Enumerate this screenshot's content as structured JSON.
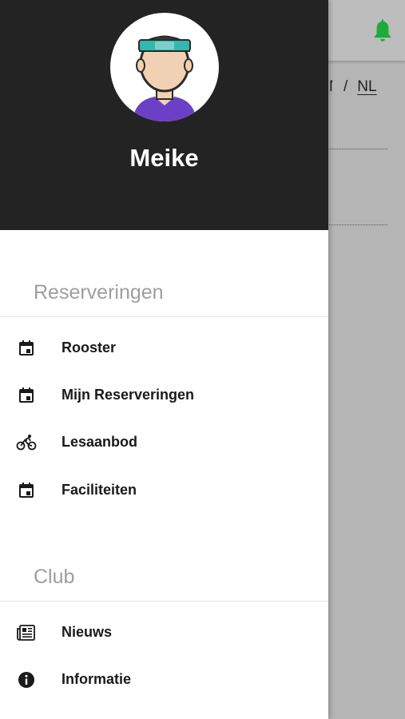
{
  "user": {
    "name": "Meike"
  },
  "language": {
    "current": "NL",
    "separator": "/"
  },
  "sections": [
    {
      "title": "Reserveringen",
      "items": [
        {
          "label": "Rooster",
          "icon": "calendar-icon"
        },
        {
          "label": "Mijn Reserveringen",
          "icon": "calendar-icon"
        },
        {
          "label": "Lesaanbod",
          "icon": "bicycle-icon"
        },
        {
          "label": "Faciliteiten",
          "icon": "calendar-icon"
        }
      ]
    },
    {
      "title": "Club",
      "items": [
        {
          "label": "Nieuws",
          "icon": "newspaper-icon"
        },
        {
          "label": "Informatie",
          "icon": "info-icon"
        }
      ]
    }
  ],
  "colors": {
    "header_bg": "#232323",
    "accent_bell": "#1faa3c",
    "section_title": "#9e9e9e",
    "overlay": "#b5b5b5"
  }
}
